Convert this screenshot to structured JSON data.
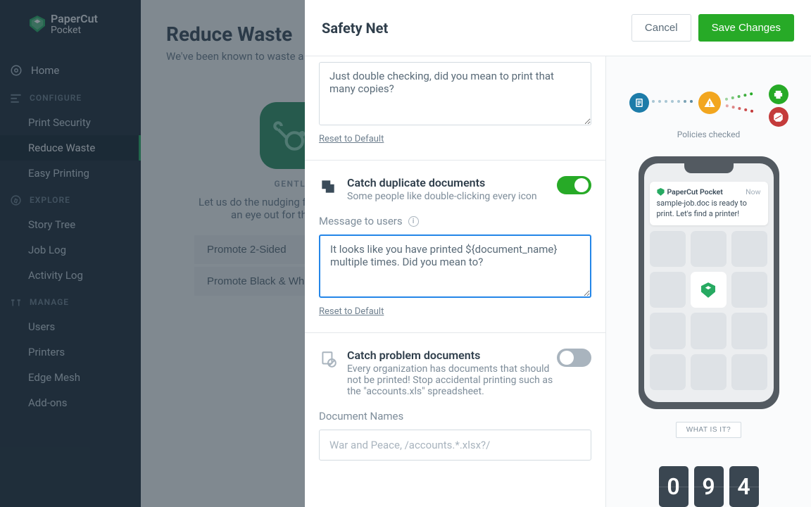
{
  "brand": {
    "name": "PaperCut",
    "sub": "Pocket"
  },
  "nav": {
    "home": "Home",
    "groups": [
      {
        "title": "CONFIGURE",
        "items": [
          "Print Security",
          "Reduce Waste",
          "Easy Printing"
        ]
      },
      {
        "title": "EXPLORE",
        "items": [
          "Story Tree",
          "Job Log",
          "Activity Log"
        ]
      },
      {
        "title": "MANAGE",
        "items": [
          "Users",
          "Printers",
          "Edge Mesh",
          "Add-ons"
        ]
      }
    ]
  },
  "page": {
    "title": "Reduce Waste",
    "subtitle": "We've been known to waste a page or two in our time.",
    "gentle_label": "GENTLE",
    "gentle_desc": "Let us do the nudging for you. We'll keep an eye out for the obvious.",
    "policy_buttons": [
      "Promote 2-Sided",
      "Promote Black & White"
    ]
  },
  "modal": {
    "title": "Safety Net",
    "cancel": "Cancel",
    "save": "Save Changes",
    "section1": {
      "textarea_value": "Just double checking, did you mean to print that many copies?",
      "reset": "Reset to Default"
    },
    "section2": {
      "title": "Catch duplicate documents",
      "sub": "Some people like double-clicking every icon",
      "toggle_on": true,
      "message_label": "Message to users",
      "textarea_value": "It looks like you have printed ${document_name} multiple times. Did you mean to?",
      "reset": "Reset to Default"
    },
    "section3": {
      "title": "Catch problem documents",
      "sub": "Every organization has documents that should not be printed! Stop accidental printing such as the \"accounts.xls\" spreadsheet.",
      "toggle_on": false,
      "docnames_label": "Document Names",
      "docnames_placeholder": "War and Peace, /accounts.*.xlsx?/"
    }
  },
  "preview": {
    "policies_label": "Policies checked",
    "notif_app": "PaperCut Pocket",
    "notif_now": "Now",
    "notif_body": "sample-job.doc is ready to print. Let's find a printer!",
    "whatisit": "WHAT IS IT?",
    "counter": [
      "0",
      "9",
      "4"
    ]
  }
}
